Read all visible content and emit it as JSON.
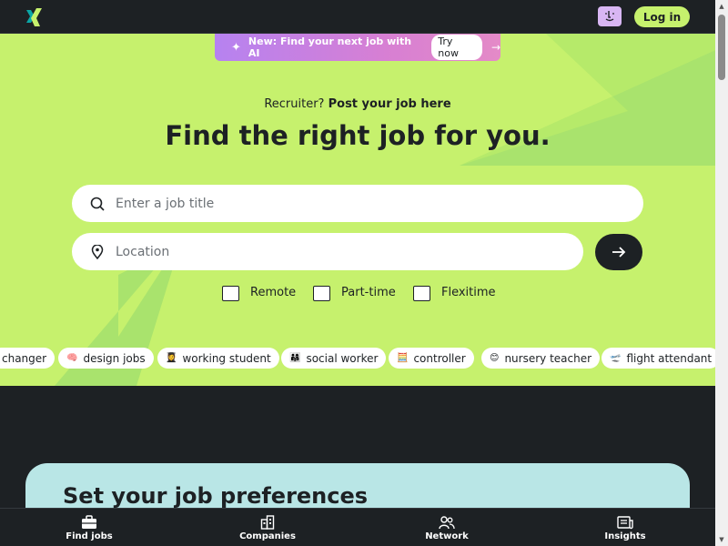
{
  "header": {
    "logo_icon": "xing-logo-icon",
    "profile_icon": "face-icon",
    "login_label": "Log in"
  },
  "ai_banner": {
    "text": "New: Find your next job with AI",
    "cta": "Try now",
    "sparkle_icon": "sparkle-icon",
    "arrow": "→"
  },
  "hero": {
    "recruiter_prefix": "Recruiter?",
    "recruiter_link": "Post your job here",
    "headline": "Find the right job for you.",
    "job_placeholder": "Enter a job title",
    "location_placeholder": "Location",
    "filters": [
      "Remote",
      "Part-time",
      "Flexitime"
    ],
    "chips": [
      {
        "emoji": "",
        "label": "changer"
      },
      {
        "emoji": "🧠",
        "label": "design jobs"
      },
      {
        "emoji": "👩‍🎓",
        "label": "working student"
      },
      {
        "emoji": "👨‍👩‍👧",
        "label": "social worker"
      },
      {
        "emoji": "🧮",
        "label": "controller"
      },
      {
        "emoji": "😊",
        "label": "nursery teacher"
      },
      {
        "emoji": "🛫",
        "label": "flight attendant"
      }
    ]
  },
  "preferences": {
    "title": "Set your job preferences"
  },
  "bottom_nav": [
    {
      "label": "Find jobs",
      "icon": "briefcase-icon"
    },
    {
      "label": "Companies",
      "icon": "building-icon"
    },
    {
      "label": "Network",
      "icon": "people-icon"
    },
    {
      "label": "Insights",
      "icon": "news-icon"
    }
  ],
  "colors": {
    "lime": "#c6f16d",
    "dark": "#1d2124",
    "teal_card": "#b9e6e6",
    "banner_gradient_start": "#b682f0",
    "banner_gradient_end": "#e48ac7"
  }
}
